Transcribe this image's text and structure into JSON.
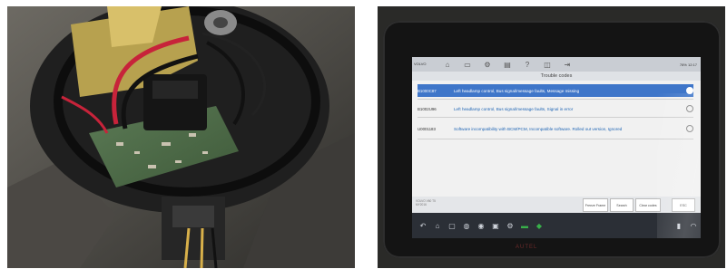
{
  "left_photo": {
    "content": "opened headlamp housing with circuit board and red/black wiring"
  },
  "right_photo": {
    "screen_title": "Trouble codes",
    "vehicle_label": "VOLVO",
    "top_icons": [
      "home-icon",
      "car-icon",
      "gear-icon",
      "print-icon",
      "help-icon",
      "window-icon",
      "exit-icon"
    ],
    "status_right": "78%  12:17",
    "codes": [
      {
        "code": "B1000C87",
        "desc": "Left headlamp control, Bus signal/message faults, Message missing",
        "selected": true
      },
      {
        "code": "B1002U96",
        "desc": "Left headlamp control, Bus signal/message faults, Signal in error",
        "selected": false
      },
      {
        "code": "U0001183",
        "desc": "Software incompatibility with BCM/PCM, Incompatible software. Rolled out version, Ignored",
        "selected": false
      }
    ],
    "footer_lines": [
      "VOLVO V60 T5",
      "MY2016"
    ],
    "buttons": [
      "Freeze Frame",
      "Search",
      "Clear codes",
      "ESC"
    ],
    "brand": "AUTEL",
    "nav_icons": [
      "back-icon",
      "home-icon",
      "recent-icon",
      "browser-icon",
      "camera-icon",
      "gallery-icon",
      "settings-icon",
      "vci-icon",
      "car-icon",
      "battery-icon",
      "wifi-icon"
    ],
    "colors": {
      "selected_row": "#3f76c9",
      "code_text": "#1e64b4",
      "nav_bar": "#2b2f36"
    }
  }
}
